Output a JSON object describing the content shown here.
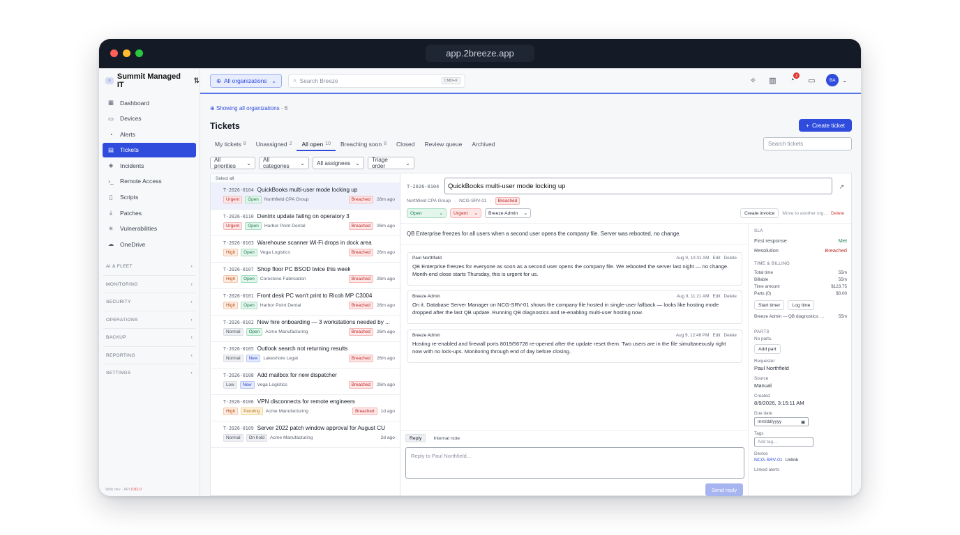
{
  "browser": {
    "url": "app.2breeze.app"
  },
  "sidebar": {
    "org_name": "Summit Managed IT",
    "org_logo": "≡",
    "items": [
      {
        "label": "Dashboard",
        "icon": "grid-icon"
      },
      {
        "label": "Devices",
        "icon": "monitor-icon"
      },
      {
        "label": "Alerts",
        "icon": "bell-icon"
      },
      {
        "label": "Tickets",
        "icon": "ticket-icon"
      },
      {
        "label": "Incidents",
        "icon": "shield-icon"
      },
      {
        "label": "Remote Access",
        "icon": "terminal-icon"
      },
      {
        "label": "Scripts",
        "icon": "scroll-icon"
      },
      {
        "label": "Patches",
        "icon": "download-icon"
      },
      {
        "label": "Vulnerabilities",
        "icon": "bug-icon"
      },
      {
        "label": "OneDrive",
        "icon": "cloud-icon"
      }
    ],
    "active_index": 3,
    "sections": [
      "AI & FLEET",
      "MONITORING",
      "SECURITY",
      "OPERATIONS",
      "BACKUP",
      "REPORTING",
      "SETTINGS"
    ],
    "version_prefix": "Web dev · API",
    "version": "0.82.0"
  },
  "topbar": {
    "org_picker": "All organizations",
    "search_placeholder": "Search Breeze",
    "search_kbd": "CMD+K",
    "notif_count": "2",
    "avatar": "BA"
  },
  "page": {
    "showing": "Showing all organizations",
    "showing_count": "· 6",
    "title": "Tickets",
    "create_label": "Create ticket",
    "tabs": [
      {
        "label": "My tickets",
        "count": "8"
      },
      {
        "label": "Unassigned",
        "count": "2"
      },
      {
        "label": "All open",
        "count": "10"
      },
      {
        "label": "Breaching soon",
        "count": "8"
      },
      {
        "label": "Closed",
        "count": ""
      },
      {
        "label": "Review queue",
        "count": ""
      },
      {
        "label": "Archived",
        "count": ""
      }
    ],
    "active_tab": 2,
    "search_tickets_placeholder": "Search tickets",
    "filters": [
      "All priorities",
      "All categories",
      "All assignees",
      "Triage order"
    ]
  },
  "list": {
    "select_all": "Select all",
    "tickets": [
      {
        "id": "T-2026-0104",
        "title": "QuickBooks multi-user mode locking up",
        "priority": "Urgent",
        "status": "Open",
        "org": "Northfield CPA Group",
        "sla": "Breached",
        "age": "26m ago"
      },
      {
        "id": "T-2026-0110",
        "title": "Dentrix update failing on operatory 3",
        "priority": "Urgent",
        "status": "Open",
        "org": "Harbor Point Dental",
        "sla": "Breached",
        "age": "26m ago"
      },
      {
        "id": "T-2026-0103",
        "title": "Warehouse scanner Wi-Fi drops in dock area",
        "priority": "High",
        "status": "Open",
        "org": "Vega Logistics",
        "sla": "Breached",
        "age": "26m ago"
      },
      {
        "id": "T-2026-0107",
        "title": "Shop floor PC BSOD twice this week",
        "priority": "High",
        "status": "Open",
        "org": "Corestone Fabrication",
        "sla": "Breached",
        "age": "26m ago"
      },
      {
        "id": "T-2026-0101",
        "title": "Front desk PC won't print to Ricoh MP C3004",
        "priority": "High",
        "status": "Open",
        "org": "Harbor Point Dental",
        "sla": "Breached",
        "age": "26m ago"
      },
      {
        "id": "T-2026-0102",
        "title": "New hire onboarding — 3 workstations needed by ...",
        "priority": "Normal",
        "status": "Open",
        "org": "Acme Manufacturing",
        "sla": "Breached",
        "age": "26m ago"
      },
      {
        "id": "T-2026-0105",
        "title": "Outlook search not returning results",
        "priority": "Normal",
        "status": "New",
        "org": "Lakeshore Legal",
        "sla": "Breached",
        "age": "26m ago"
      },
      {
        "id": "T-2026-0108",
        "title": "Add mailbox for new dispatcher",
        "priority": "Low",
        "status": "New",
        "org": "Vega Logistics",
        "sla": "Breached",
        "age": "26m ago"
      },
      {
        "id": "T-2026-0106",
        "title": "VPN disconnects for remote engineers",
        "priority": "High",
        "status": "Pending",
        "org": "Acme Manufacturing",
        "sla": "Breached",
        "age": "1d ago"
      },
      {
        "id": "T-2026-0109",
        "title": "Server 2022 patch window approval for August CU",
        "priority": "Normal",
        "status": "On hold",
        "org": "Acme Manufacturing",
        "sla": "",
        "age": "2d ago"
      }
    ]
  },
  "detail": {
    "id": "T-2026-0104",
    "title": "QuickBooks multi-user mode locking up",
    "org": "Northfield CPA Group",
    "device": "NCG-SRV-01",
    "sla_badge": "Breached",
    "status": "Open",
    "priority": "Urgent",
    "assignee": "Breeze Admin",
    "create_invoice": "Create invoice",
    "move": "Move to another org...",
    "delete": "Delete",
    "description": "QB Enterprise freezes for all users when a second user opens the company file. Server was rebooted, no change.",
    "messages": [
      {
        "author": "Paul Northfield",
        "time": "Aug 9, 10:31 AM",
        "edit": "Edit",
        "del": "Delete",
        "body": "QB Enterprise freezes for everyone as soon as a second user opens the company file. We rebooted the server last night — no change. Month-end close starts Thursday, this is urgent for us."
      },
      {
        "author": "Breeze Admin",
        "time": "Aug 9, 11:21 AM",
        "edit": "Edit",
        "del": "Delete",
        "body": "On it. Database Server Manager on NCG-SRV-01 shows the company file hosted in single-user fallback — looks like hosting mode dropped after the last QB update. Running QB diagnostics and re-enabling multi-user hosting now."
      },
      {
        "author": "Breeze Admin",
        "time": "Aug 9, 12:46 PM",
        "edit": "Edit",
        "del": "Delete",
        "body": "Hosting re-enabled and firewall ports 8019/56728 re-opened after the update reset them. Two users are in the file simultaneously right now with no lock-ups. Monitoring through end of day before closing."
      }
    ],
    "reply_tab": "Reply",
    "note_tab": "Internal note",
    "reply_placeholder": "Reply to Paul Northfield...",
    "send": "Send reply"
  },
  "side": {
    "sla_title": "SLA",
    "first_response_label": "First response",
    "first_response": "Met",
    "resolution_label": "Resolution",
    "resolution": "Breached",
    "tb_title": "TIME & BILLING",
    "total_time_label": "Total time",
    "total_time": "55m",
    "billable_label": "Billable",
    "billable": "55m",
    "time_amount_label": "Time amount",
    "time_amount": "$123.75",
    "parts_label": "Parts (0)",
    "parts_amount": "$0.00",
    "start_timer": "Start timer",
    "log_time": "Log time",
    "entry": "Breeze Admin — QB diagnostics: ...",
    "entry_time": "55m",
    "parts_title": "PARTS",
    "no_parts": "No parts.",
    "add_part": "Add part",
    "requester_label": "Requester",
    "requester": "Paul Northfield",
    "source_label": "Source",
    "source": "Manual",
    "created_label": "Created",
    "created": "8/9/2026, 3:15:11 AM",
    "due_label": "Due date",
    "due_placeholder": "mm/dd/yyyy",
    "tags_label": "Tags",
    "tags_placeholder": "Add tag...",
    "device_label": "Device",
    "device": "NCG-SRV-01",
    "unlink": "Unlink",
    "linked_label": "Linked alerts"
  }
}
